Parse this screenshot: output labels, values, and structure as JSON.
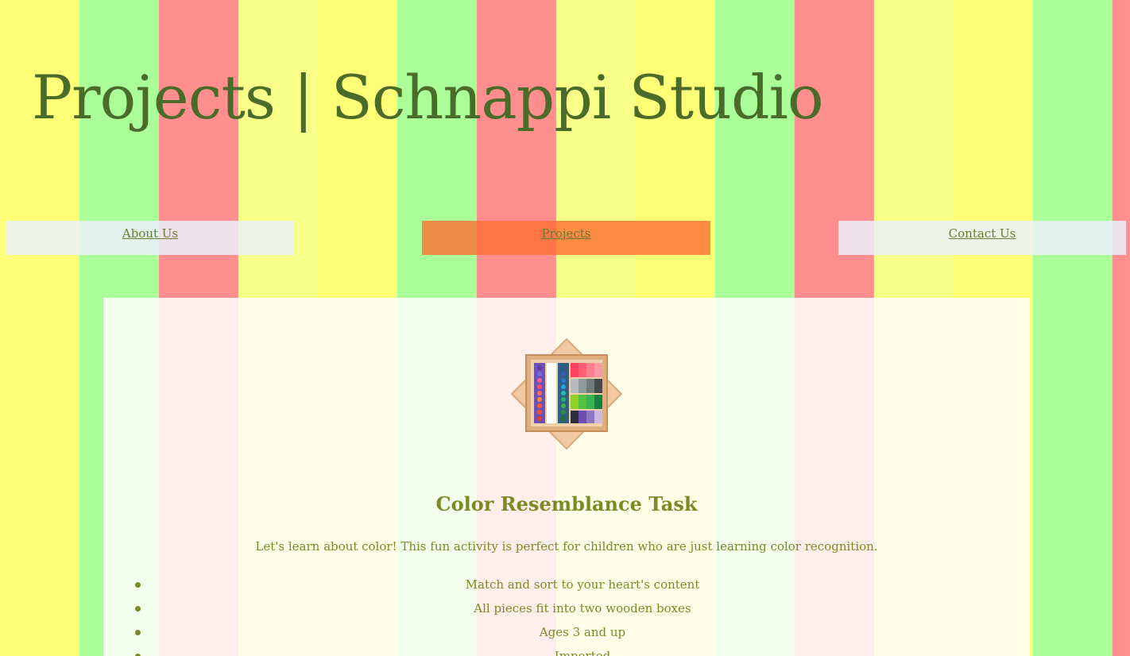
{
  "header": {
    "title": "Projects | Schnappi Studio"
  },
  "nav": {
    "about": "About Us",
    "projects": "Projects",
    "contact": "Contact Us"
  },
  "project": {
    "image_icon": "color-box-icon",
    "title": "Color Resemblance Task",
    "description": "Let's learn about color! This fun activity is perfect for children who are just learning color recognition.",
    "features": [
      "Match and sort to your heart's content",
      "All pieces fit into two wooden boxes",
      "Ages 3 and up",
      "Imported"
    ]
  },
  "colors": {
    "stripe_yellow": "#ffff77",
    "stripe_green": "#aaff99",
    "stripe_red": "#ff8f8f",
    "stripe_light_yellow": "#f7ff88",
    "title_green": "#4a6b2a",
    "active_tab": "#ff6e32",
    "text_olive": "#7a8a24"
  }
}
